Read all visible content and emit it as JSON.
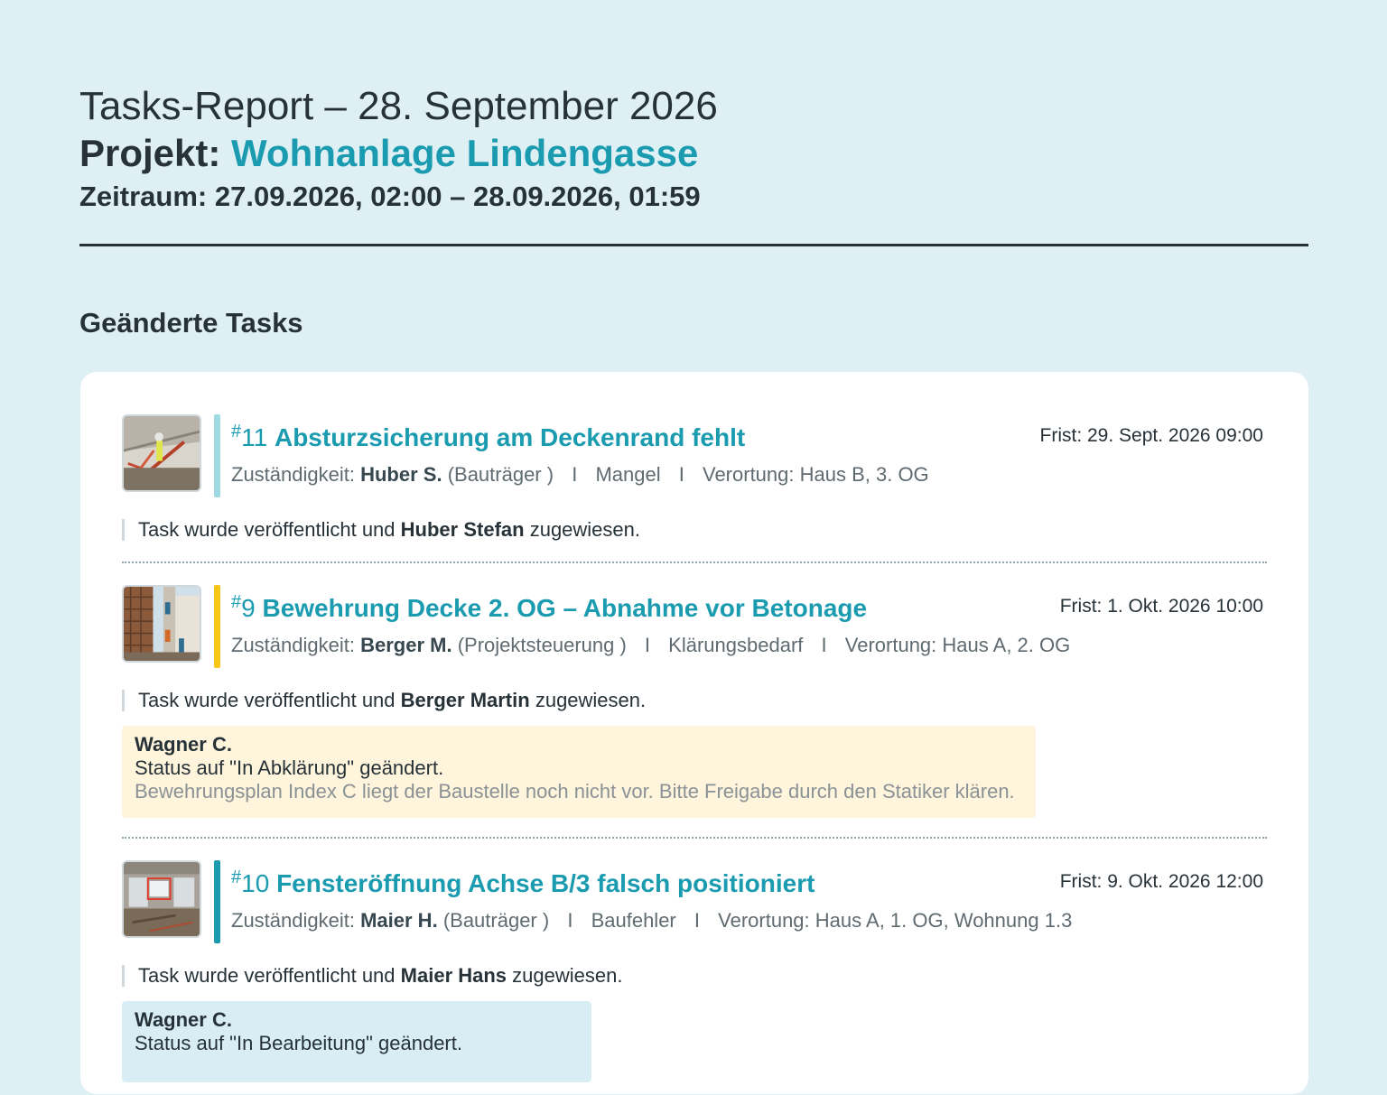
{
  "header": {
    "title": "Tasks-Report – 28. September 2026",
    "project_label": "Projekt:",
    "project_name": "Wohnanlage Lindengasse",
    "range": "Zeitraum: 27.09.2026, 02:00 – 28.09.2026, 01:59"
  },
  "section_title": "Geänderte Tasks",
  "labels": {
    "hash": "#",
    "responsibility": "Zuständigkeit:",
    "separator": "I",
    "published_prefix": "Task wurde veröffentlicht und",
    "published_suffix": "zugewiesen."
  },
  "tasks": [
    {
      "number": "11",
      "title": "Absturzsicherung am Deckenrand fehlt",
      "deadline": "Frist: 29. Sept. 2026 09:00",
      "assignee_short": "Huber S.",
      "role": "(Bauträger )",
      "type": "Mangel",
      "location": "Verortung: Haus B, 3. OG",
      "assignee_full": "Huber Stefan",
      "bar_color": "#9fdae3",
      "thumb_icon": "construction-photo-icon"
    },
    {
      "number": "9",
      "title": "Bewehrung Decke 2. OG – Abnahme vor Betonage",
      "deadline": "Frist: 1. Okt. 2026 10:00",
      "assignee_short": "Berger M.",
      "role": "(Projektsteuerung )",
      "type": "Klärungsbedarf",
      "location": "Verortung: Haus A, 2. OG",
      "assignee_full": "Berger Martin",
      "bar_color": "#f5c518",
      "thumb_icon": "scaffold-photo-icon",
      "comment": {
        "author": "Wagner C.",
        "status": "Status auf \"In Abklärung\" geändert.",
        "text": "Bewehrungsplan Index C liegt der Baustelle noch nicht vor. Bitte Freigabe durch den Statiker klären.",
        "bg_color": "#fff4dc"
      }
    },
    {
      "number": "10",
      "title": "Fensteröffnung Achse B/3 falsch positioniert",
      "deadline": "Frist: 9. Okt. 2026 12:00",
      "assignee_short": "Maier H.",
      "role": "(Bauträger )",
      "type": "Baufehler",
      "location": "Verortung: Haus A, 1. OG, Wohnung 1.3",
      "assignee_full": "Maier Hans",
      "bar_color": "#1a9bb0",
      "thumb_icon": "window-photo-icon",
      "comment": {
        "author": "Wagner C.",
        "status": "Status auf \"In Bearbeitung\" geändert.",
        "bg_color": "#d8eef4"
      }
    }
  ]
}
